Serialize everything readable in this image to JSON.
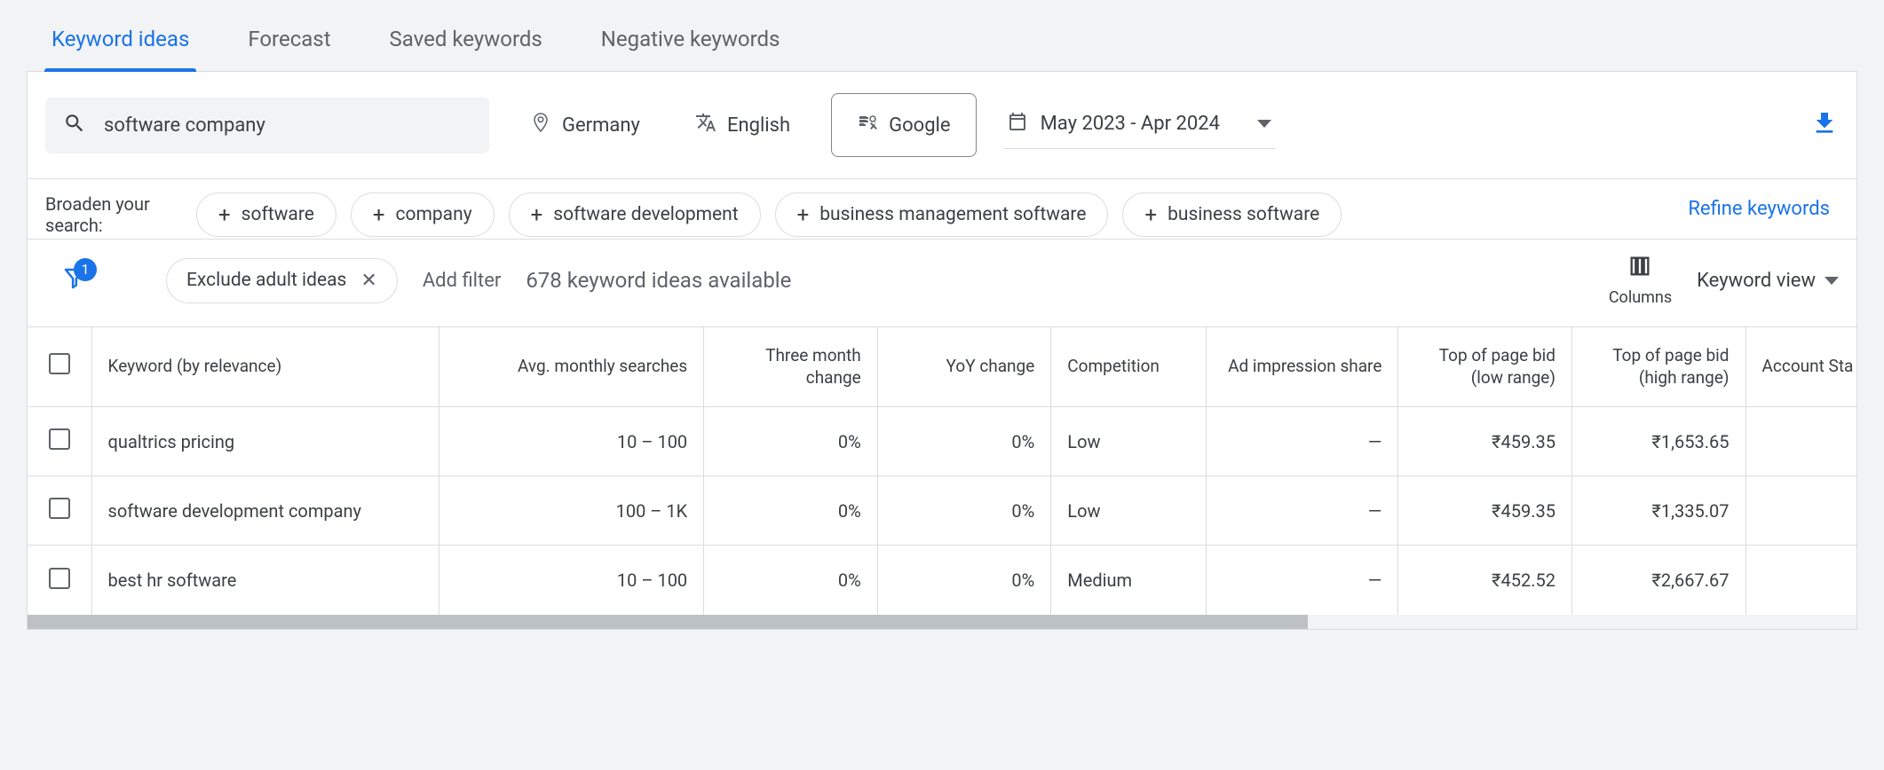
{
  "tabs": {
    "keyword_ideas": "Keyword ideas",
    "forecast": "Forecast",
    "saved_keywords": "Saved keywords",
    "negative_keywords": "Negative keywords"
  },
  "filters": {
    "search_value": "software company",
    "location": "Germany",
    "language": "English",
    "network": "Google",
    "date_range": "May 2023 - Apr 2024"
  },
  "broaden": {
    "label": "Broaden your search:",
    "chips": [
      "software",
      "company",
      "software development",
      "business management software",
      "business software"
    ]
  },
  "refine_label": "Refine keywords",
  "toolbar": {
    "filter_badge": "1",
    "applied_filter": "Exclude adult ideas",
    "add_filter": "Add filter",
    "ideas_available": "678 keyword ideas available",
    "columns_label": "Columns",
    "keyword_view": "Keyword view"
  },
  "columns": {
    "keyword": "Keyword (by relevance)",
    "avg": "Avg. monthly searches",
    "three_month": "Three month change",
    "yoy": "YoY change",
    "competition": "Competition",
    "ad_impr": "Ad impression share",
    "bid_low": "Top of page bid (low range)",
    "bid_high": "Top of page bid (high range)",
    "account": "Account Sta"
  },
  "rows": [
    {
      "keyword": "qualtrics pricing",
      "avg": "10 – 100",
      "three_month": "0%",
      "yoy": "0%",
      "competition": "Low",
      "ad_impr": "—",
      "bid_low": "₹459.35",
      "bid_high": "₹1,653.65"
    },
    {
      "keyword": "software development company",
      "avg": "100 – 1K",
      "three_month": "0%",
      "yoy": "0%",
      "competition": "Low",
      "ad_impr": "—",
      "bid_low": "₹459.35",
      "bid_high": "₹1,335.07"
    },
    {
      "keyword": "best hr software",
      "avg": "10 – 100",
      "three_month": "0%",
      "yoy": "0%",
      "competition": "Medium",
      "ad_impr": "—",
      "bid_low": "₹452.52",
      "bid_high": "₹2,667.67"
    }
  ]
}
